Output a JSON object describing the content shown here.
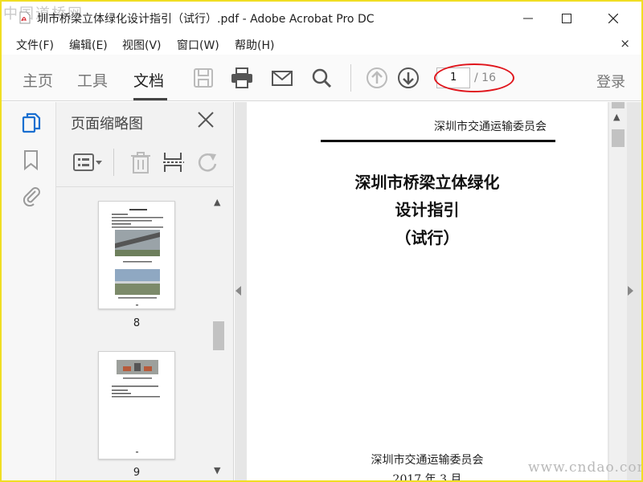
{
  "watermark": {
    "top": "中国道桥网",
    "bottom": "www.cndao.com"
  },
  "window": {
    "title": "圳市桥梁立体绿化设计指引（试行）.pdf - Adobe Acrobat Pro DC"
  },
  "menu": {
    "items": [
      "文件(F)",
      "编辑(E)",
      "视图(V)",
      "窗口(W)",
      "帮助(H)"
    ],
    "close": "×"
  },
  "toolbar": {
    "tabs": [
      "主页",
      "工具",
      "文档"
    ],
    "active_tab": "文档",
    "page_current": "1",
    "page_total": "/ 16",
    "login": "登录"
  },
  "thumbnails": {
    "title": "页面缩略图",
    "pages": [
      {
        "label": "8"
      },
      {
        "label": "9"
      }
    ]
  },
  "document": {
    "header": "深圳市交通运输委员会",
    "title_lines": [
      "深圳市桥梁立体绿化",
      "设计指引",
      "（试行）"
    ],
    "footer_org": "深圳市交通运输委员会",
    "footer_date": "2017 年 3 月"
  },
  "colors": {
    "frame": "#f0de23",
    "highlight": "#e0151c",
    "accent_blue": "#1a6fd0"
  }
}
